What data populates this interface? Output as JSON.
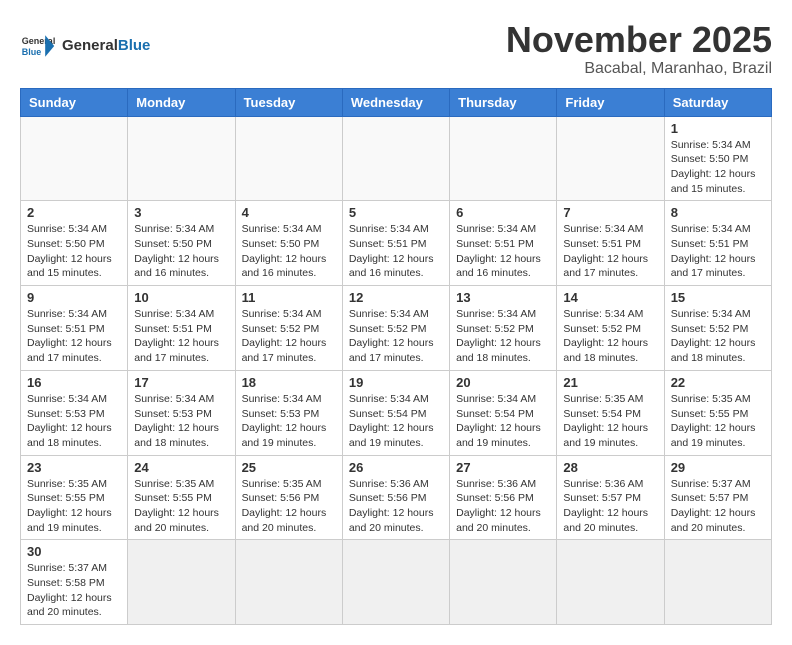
{
  "logo": {
    "text_general": "General",
    "text_blue": "Blue"
  },
  "title": "November 2025",
  "subtitle": "Bacabal, Maranhao, Brazil",
  "weekdays": [
    "Sunday",
    "Monday",
    "Tuesday",
    "Wednesday",
    "Thursday",
    "Friday",
    "Saturday"
  ],
  "weeks": [
    [
      {
        "day": "",
        "info": ""
      },
      {
        "day": "",
        "info": ""
      },
      {
        "day": "",
        "info": ""
      },
      {
        "day": "",
        "info": ""
      },
      {
        "day": "",
        "info": ""
      },
      {
        "day": "",
        "info": ""
      },
      {
        "day": "1",
        "info": "Sunrise: 5:34 AM\nSunset: 5:50 PM\nDaylight: 12 hours and 15 minutes."
      }
    ],
    [
      {
        "day": "2",
        "info": "Sunrise: 5:34 AM\nSunset: 5:50 PM\nDaylight: 12 hours and 15 minutes."
      },
      {
        "day": "3",
        "info": "Sunrise: 5:34 AM\nSunset: 5:50 PM\nDaylight: 12 hours and 16 minutes."
      },
      {
        "day": "4",
        "info": "Sunrise: 5:34 AM\nSunset: 5:50 PM\nDaylight: 12 hours and 16 minutes."
      },
      {
        "day": "5",
        "info": "Sunrise: 5:34 AM\nSunset: 5:51 PM\nDaylight: 12 hours and 16 minutes."
      },
      {
        "day": "6",
        "info": "Sunrise: 5:34 AM\nSunset: 5:51 PM\nDaylight: 12 hours and 16 minutes."
      },
      {
        "day": "7",
        "info": "Sunrise: 5:34 AM\nSunset: 5:51 PM\nDaylight: 12 hours and 17 minutes."
      },
      {
        "day": "8",
        "info": "Sunrise: 5:34 AM\nSunset: 5:51 PM\nDaylight: 12 hours and 17 minutes."
      }
    ],
    [
      {
        "day": "9",
        "info": "Sunrise: 5:34 AM\nSunset: 5:51 PM\nDaylight: 12 hours and 17 minutes."
      },
      {
        "day": "10",
        "info": "Sunrise: 5:34 AM\nSunset: 5:51 PM\nDaylight: 12 hours and 17 minutes."
      },
      {
        "day": "11",
        "info": "Sunrise: 5:34 AM\nSunset: 5:52 PM\nDaylight: 12 hours and 17 minutes."
      },
      {
        "day": "12",
        "info": "Sunrise: 5:34 AM\nSunset: 5:52 PM\nDaylight: 12 hours and 17 minutes."
      },
      {
        "day": "13",
        "info": "Sunrise: 5:34 AM\nSunset: 5:52 PM\nDaylight: 12 hours and 18 minutes."
      },
      {
        "day": "14",
        "info": "Sunrise: 5:34 AM\nSunset: 5:52 PM\nDaylight: 12 hours and 18 minutes."
      },
      {
        "day": "15",
        "info": "Sunrise: 5:34 AM\nSunset: 5:52 PM\nDaylight: 12 hours and 18 minutes."
      }
    ],
    [
      {
        "day": "16",
        "info": "Sunrise: 5:34 AM\nSunset: 5:53 PM\nDaylight: 12 hours and 18 minutes."
      },
      {
        "day": "17",
        "info": "Sunrise: 5:34 AM\nSunset: 5:53 PM\nDaylight: 12 hours and 18 minutes."
      },
      {
        "day": "18",
        "info": "Sunrise: 5:34 AM\nSunset: 5:53 PM\nDaylight: 12 hours and 19 minutes."
      },
      {
        "day": "19",
        "info": "Sunrise: 5:34 AM\nSunset: 5:54 PM\nDaylight: 12 hours and 19 minutes."
      },
      {
        "day": "20",
        "info": "Sunrise: 5:34 AM\nSunset: 5:54 PM\nDaylight: 12 hours and 19 minutes."
      },
      {
        "day": "21",
        "info": "Sunrise: 5:35 AM\nSunset: 5:54 PM\nDaylight: 12 hours and 19 minutes."
      },
      {
        "day": "22",
        "info": "Sunrise: 5:35 AM\nSunset: 5:55 PM\nDaylight: 12 hours and 19 minutes."
      }
    ],
    [
      {
        "day": "23",
        "info": "Sunrise: 5:35 AM\nSunset: 5:55 PM\nDaylight: 12 hours and 19 minutes."
      },
      {
        "day": "24",
        "info": "Sunrise: 5:35 AM\nSunset: 5:55 PM\nDaylight: 12 hours and 20 minutes."
      },
      {
        "day": "25",
        "info": "Sunrise: 5:35 AM\nSunset: 5:56 PM\nDaylight: 12 hours and 20 minutes."
      },
      {
        "day": "26",
        "info": "Sunrise: 5:36 AM\nSunset: 5:56 PM\nDaylight: 12 hours and 20 minutes."
      },
      {
        "day": "27",
        "info": "Sunrise: 5:36 AM\nSunset: 5:56 PM\nDaylight: 12 hours and 20 minutes."
      },
      {
        "day": "28",
        "info": "Sunrise: 5:36 AM\nSunset: 5:57 PM\nDaylight: 12 hours and 20 minutes."
      },
      {
        "day": "29",
        "info": "Sunrise: 5:37 AM\nSunset: 5:57 PM\nDaylight: 12 hours and 20 minutes."
      }
    ],
    [
      {
        "day": "30",
        "info": "Sunrise: 5:37 AM\nSunset: 5:58 PM\nDaylight: 12 hours and 20 minutes."
      },
      {
        "day": "",
        "info": ""
      },
      {
        "day": "",
        "info": ""
      },
      {
        "day": "",
        "info": ""
      },
      {
        "day": "",
        "info": ""
      },
      {
        "day": "",
        "info": ""
      },
      {
        "day": "",
        "info": ""
      }
    ]
  ]
}
